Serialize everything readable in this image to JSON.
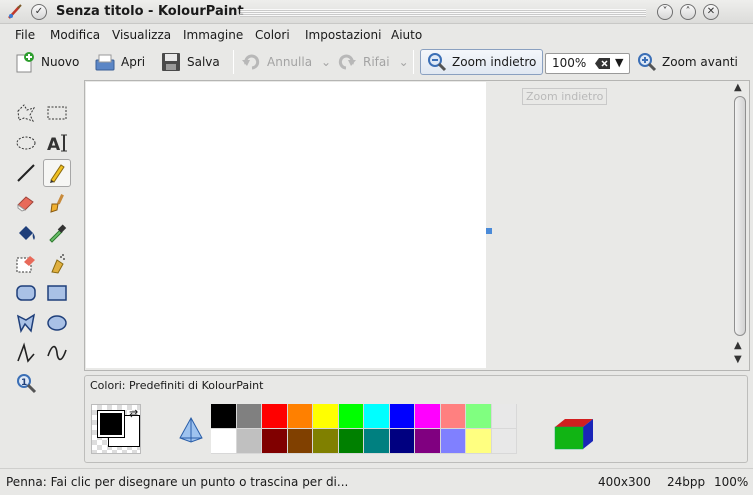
{
  "window": {
    "title": "Senza titolo - KolourPaint"
  },
  "menubar": {
    "items": [
      {
        "label": "File"
      },
      {
        "label": "Modifica"
      },
      {
        "label": "Visualizza"
      },
      {
        "label": "Immagine"
      },
      {
        "label": "Colori"
      },
      {
        "label": "Impostazioni"
      },
      {
        "label": "Aiuto"
      }
    ]
  },
  "toolbar": {
    "new_label": "Nuovo",
    "open_label": "Apri",
    "save_label": "Salva",
    "undo_label": "Annulla",
    "redo_label": "Rifai",
    "zoom_out_label": "Zoom indietro",
    "zoom_value": "100%",
    "zoom_in_label": "Zoom avanti"
  },
  "tools": [
    {
      "icon": "free-form-select-icon"
    },
    {
      "icon": "rectangular-select-icon"
    },
    {
      "icon": "elliptical-select-icon"
    },
    {
      "icon": "text-tool-icon"
    },
    {
      "icon": "line-tool-icon"
    },
    {
      "icon": "pen-tool-icon",
      "active": true
    },
    {
      "icon": "eraser-icon"
    },
    {
      "icon": "brush-icon"
    },
    {
      "icon": "flood-fill-icon"
    },
    {
      "icon": "color-picker-icon"
    },
    {
      "icon": "color-eraser-icon"
    },
    {
      "icon": "spraycan-icon"
    },
    {
      "icon": "rounded-rectangle-icon"
    },
    {
      "icon": "rectangle-icon"
    },
    {
      "icon": "polygon-icon"
    },
    {
      "icon": "ellipse-icon"
    },
    {
      "icon": "connected-lines-icon"
    },
    {
      "icon": "curve-icon"
    },
    {
      "icon": "zoom-tool-icon"
    }
  ],
  "canvas": {
    "tooltip": "Zoom indietro"
  },
  "colors_panel": {
    "title": "Colori: Predefiniti di KolourPaint",
    "foreground": "#000000",
    "background": "#ffffff",
    "palette_row1": [
      "#000000",
      "#808080",
      "#ff0000",
      "#ff8000",
      "#ffff00",
      "#00ff00",
      "#00ffff",
      "#0000ff",
      "#ff00ff",
      "#ff8080",
      "#80ff80",
      "#e8e8e8"
    ],
    "palette_row2": [
      "#ffffff",
      "#c0c0c0",
      "#800000",
      "#804000",
      "#808000",
      "#008000",
      "#008080",
      "#000080",
      "#800080",
      "#8080ff",
      "#ffff80",
      "#e8e8e8"
    ]
  },
  "statusbar": {
    "message": "Penna: Fai clic per disegnare un punto o trascina per di...",
    "image_size": "400x300",
    "color_depth": "24bpp",
    "zoom": "100%"
  }
}
